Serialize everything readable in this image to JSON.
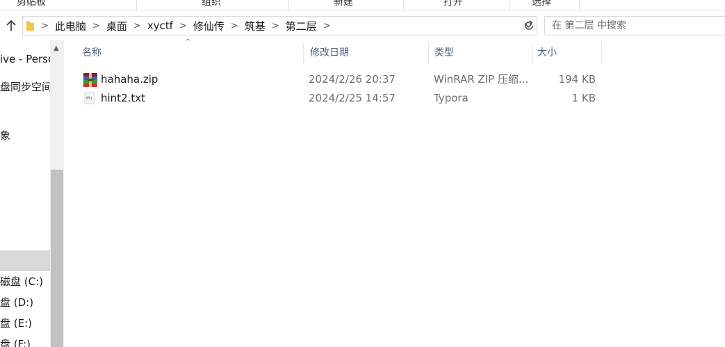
{
  "ribbon": {
    "groups": [
      "剪贴板",
      "组织",
      "新建",
      "打开",
      "选择"
    ]
  },
  "address": {
    "breadcrumbs": [
      "此电脑",
      "桌面",
      "xyctf",
      "修仙传",
      "筑基",
      "第二层"
    ]
  },
  "search": {
    "placeholder": "在 第二层 中搜索"
  },
  "nav": {
    "items": [
      {
        "label": "ive - Perso",
        "selected": false
      },
      {
        "label": "盘同步空间",
        "selected": false
      },
      {
        "label": "象",
        "selected": false
      },
      {
        "label": "",
        "selected": true
      },
      {
        "label": "磁盘 (C:)",
        "selected": false
      },
      {
        "label": "盘 (D:)",
        "selected": false
      },
      {
        "label": "盘 (E:)",
        "selected": false
      },
      {
        "label": "盘 (F:)",
        "selected": false
      }
    ]
  },
  "columns": {
    "name": "名称",
    "date": "修改日期",
    "type": "类型",
    "size": "大小"
  },
  "files": [
    {
      "name": "hahaha.zip",
      "date": "2024/2/26 20:37",
      "type": "WinRAR ZIP 压缩...",
      "size": "194 KB",
      "icon": "winrar-zip-icon"
    },
    {
      "name": "hint2.txt",
      "date": "2024/2/25 14:57",
      "type": "Typora",
      "size": "1 KB",
      "icon": "typora-file-icon"
    }
  ],
  "colors": {
    "selected_nav": "#d9d9d9",
    "header_text": "#4c607a",
    "meta_text": "#6d6d6d",
    "folder_yellow": "#f4c542"
  }
}
